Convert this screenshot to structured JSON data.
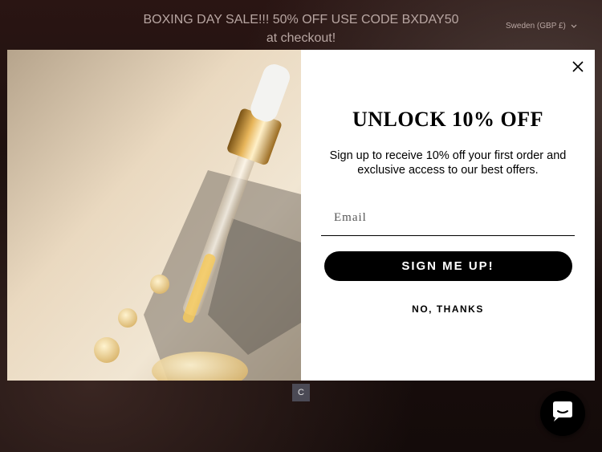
{
  "announcement": {
    "line1": "BOXING DAY SALE!!! 50% OFF USE CODE BXDAY50",
    "line2": "at checkout!"
  },
  "currency_selector": {
    "label": "Sweden (GBP £)",
    "icon": "chevron-down-icon"
  },
  "popup": {
    "headline": "UNLOCK 10% OFF",
    "subtext": "Sign up to receive 10% off your first order and exclusive access to our best offers.",
    "email_placeholder": "Email",
    "email_value": "",
    "signup_label": "SIGN ME UP!",
    "decline_label": "NO, THANKS",
    "close_icon": "close-icon",
    "image_subject": "serum dropper with oil drops"
  },
  "background_bar": {
    "text": "C"
  },
  "chat": {
    "icon": "chat-bubble-icon",
    "color": "#000000"
  },
  "colors": {
    "background": "#1c100e",
    "announcement_text": "#b8a6a2",
    "button": "#000000",
    "button_text": "#ffffff"
  }
}
